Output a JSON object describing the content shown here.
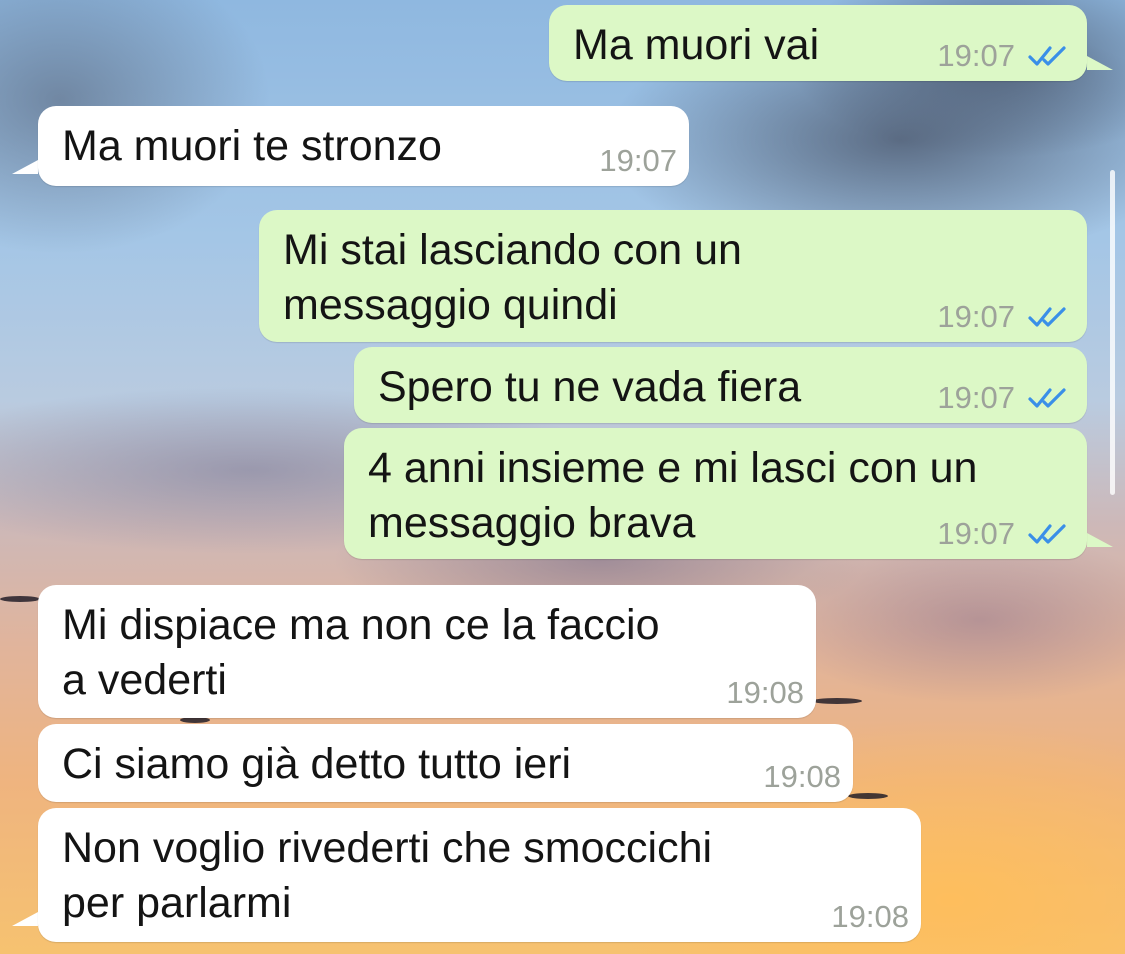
{
  "theme": {
    "outgoing_bubble": "#dcf8c6",
    "incoming_bubble": "#ffffff",
    "read_tick_color": "#3a8fe8",
    "timestamp_color": "#9da29a"
  },
  "messages": [
    {
      "direction": "outgoing",
      "lines": [
        "Ma muori vai"
      ],
      "time": "19:07",
      "status": "read"
    },
    {
      "direction": "incoming",
      "lines": [
        "Ma muori te stronzo"
      ],
      "time": "19:07"
    },
    {
      "direction": "outgoing",
      "lines": [
        "Mi stai lasciando con un",
        "messaggio quindi"
      ],
      "time": "19:07",
      "status": "read"
    },
    {
      "direction": "outgoing",
      "lines": [
        "Spero tu ne vada fiera"
      ],
      "time": "19:07",
      "status": "read"
    },
    {
      "direction": "outgoing",
      "lines": [
        "4 anni insieme e mi lasci con un",
        "messaggio brava"
      ],
      "time": "19:07",
      "status": "read"
    },
    {
      "direction": "incoming",
      "lines": [
        "Mi dispiace ma non ce la faccio",
        "a vederti"
      ],
      "time": "19:08"
    },
    {
      "direction": "incoming",
      "lines": [
        "Ci siamo già detto tutto ieri"
      ],
      "time": "19:08"
    },
    {
      "direction": "incoming",
      "lines": [
        "Non voglio rivederti che smoccichi",
        "per parlarmi"
      ],
      "time": "19:08"
    }
  ]
}
